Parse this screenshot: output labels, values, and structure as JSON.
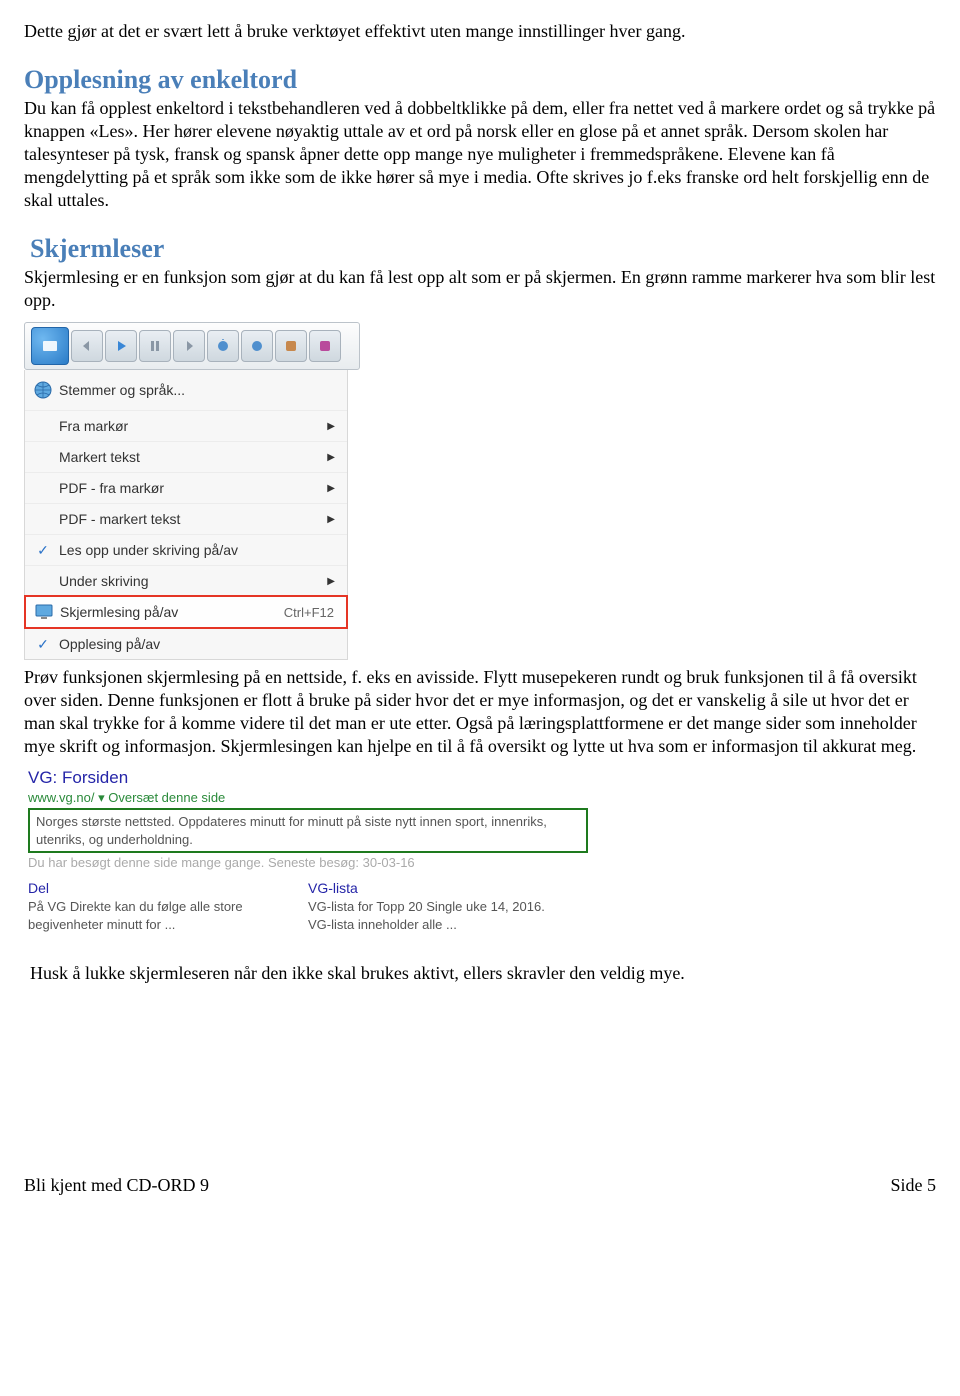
{
  "intro": {
    "p1": "Dette gjør at det er svært lett å bruke verktøyet effektivt uten mange innstillinger hver gang."
  },
  "opplesning": {
    "heading": "Opplesning av enkeltord",
    "body": "Du kan få opplest enkeltord i tekstbehandleren ved å dobbeltklikke på dem, eller fra nettet ved å markere ordet og så trykke på knappen «Les». Her hører elevene nøyaktig uttale av et ord på norsk eller en glose på et annet språk. Dersom skolen har talesynteser på tysk, fransk og spansk åpner dette opp mange nye muligheter i fremmedspråkene. Elevene kan få mengdelytting på et språk som ikke som de ikke hører så mye i media. Ofte skrives jo f.eks franske ord helt forskjellig enn de skal uttales."
  },
  "skjermleser": {
    "heading": "Skjermleser",
    "intro": "Skjermlesing er en funksjon som gjør at du kan få lest opp alt som er på skjermen. En grønn ramme markerer hva som blir lest opp.",
    "after": "Prøv funksjonen skjermlesing på en nettside, f. eks en avisside. Flytt musepekeren rundt og bruk funksjonen til å få oversikt over siden. Denne funksjonen er flott å bruke på sider hvor det er mye informasjon, og det er vanskelig å sile ut hvor det er man skal trykke for å komme videre til det man er ute etter. Også på læringsplattformene er det mange sider som inneholder mye skrift og informasjon. Skjermlesingen kan hjelpe en til å få oversikt og lytte ut hva som er informasjon til akkurat meg.",
    "closing": "Husk å lukke skjermleseren når den ikke skal brukes aktivt, ellers skravler den veldig mye."
  },
  "menu": {
    "header": "Stemmer og språk...",
    "items": [
      {
        "label": "Fra markør",
        "arrow": true
      },
      {
        "label": "Markert tekst",
        "arrow": true
      },
      {
        "label": "PDF - fra markør",
        "arrow": true
      },
      {
        "label": "PDF - markert tekst",
        "arrow": true
      },
      {
        "label": "Les opp under skriving på/av",
        "check": true
      },
      {
        "label": "Under skriving",
        "arrow": true
      },
      {
        "label": "Skjermlesing på/av",
        "shortcut": "Ctrl+F12",
        "highlight": true,
        "icon": "screen"
      },
      {
        "label": "Opplesing på/av",
        "check": true
      }
    ]
  },
  "vg": {
    "title": "VG: Forsiden",
    "url": "www.vg.no/ ▾ Oversæt denne side",
    "desc": "Norges største nettsted. Oppdateres minutt for minutt på siste nytt innen sport, innenriks, utenriks, og underholdning.",
    "visited": "Du har besøgt denne side mange gange. Seneste besøg: 30-03-16",
    "cols": [
      {
        "title": "Del",
        "text": "På VG Direkte kan du følge alle store begivenheter minutt for ..."
      },
      {
        "title": "VG-lista",
        "text": "VG-lista for Topp 20 Single uke 14, 2016. VG-lista inneholder alle ..."
      }
    ]
  },
  "footer": {
    "left": "Bli kjent med CD-ORD 9",
    "right": "Side 5"
  }
}
